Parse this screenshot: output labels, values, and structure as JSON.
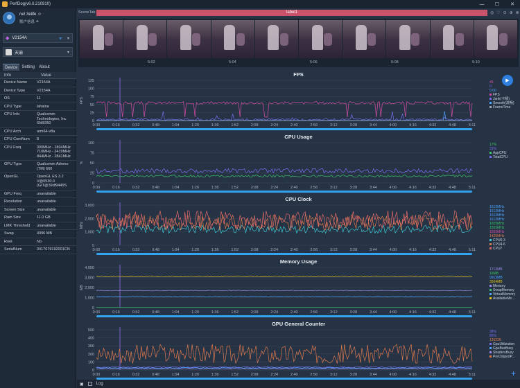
{
  "window": {
    "title": "PerfDog(v6.0.210910)",
    "min": "—",
    "max": "☐",
    "close": "✕"
  },
  "user": {
    "name": "ne! 3elife ☺",
    "sub": "账户信息 ≗"
  },
  "device_select": {
    "icon": "◆",
    "name": "V2154A",
    "wifi": "ᯤ",
    "caret": "▾"
  },
  "app_select": {
    "name": "天谕",
    "caret": "▾"
  },
  "tabs": [
    {
      "label": "Device"
    },
    {
      "label": "Setting"
    },
    {
      "label": "About"
    }
  ],
  "info_table": {
    "headers": [
      "Info",
      "Value"
    ],
    "rows": [
      {
        "k": "Device Name",
        "v": "V2154A"
      },
      {
        "k": "Device Type",
        "v": "V2154A"
      },
      {
        "k": "OS",
        "v": "11"
      },
      {
        "k": "CPU Type",
        "v": "lahaina"
      },
      {
        "k": "CPU Info",
        "v": "Qualcomm\nTechnologies, Inc\nSM8350"
      },
      {
        "k": "CPU Arch",
        "v": "arm64-v8a"
      },
      {
        "k": "CPU CoreNum",
        "v": "8"
      },
      {
        "k": "CPU Freq",
        "v": "300MHz - 1804MHz\n710MHz - 2419MHz\n844MHz - 2841MHz"
      },
      {
        "k": "GPU Type",
        "v": "Qualcomm Adreno\n(TM) 660"
      },
      {
        "k": "OpenGL",
        "v": "OpenGL ES 3.2\nV@0530.0\n(GIT@39df9449S"
      },
      {
        "k": "GPU Freq",
        "v": "unavailable"
      },
      {
        "k": "Resolution",
        "v": "unavailable"
      },
      {
        "k": "Screen Size",
        "v": "unavailable"
      },
      {
        "k": "Ram Size",
        "v": "11.0 GB"
      },
      {
        "k": "LMK Threshold",
        "v": "unavailable"
      },
      {
        "k": "Swap",
        "v": "4096 MB"
      },
      {
        "k": "Root",
        "v": "No"
      },
      {
        "k": "SerialNum",
        "v": "3417679192001CN"
      }
    ]
  },
  "scene": {
    "tab_label": "SceneTab",
    "label": "label1",
    "icons": [
      "◎",
      "♡",
      "⊙",
      "⊕",
      "⊗"
    ]
  },
  "frame_times": [
    "5:02",
    "5:04",
    "5:06",
    "5:08",
    "5:10"
  ],
  "buttons": {
    "play": "▶",
    "plus": "+"
  },
  "footer": {
    "log": "Log"
  },
  "colors": {
    "pink": "#d94ea8",
    "purple": "#7b6ff2",
    "blue": "#4da3ff",
    "green": "#3cc46a",
    "orange": "#e07a4f",
    "cyan": "#3fc9d4",
    "yellow": "#e3c21c",
    "lavender": "#9d8be8"
  },
  "chart_data": [
    {
      "type": "line",
      "title": "FPS",
      "ylabel": "FPS",
      "ylim": [
        0,
        125
      ],
      "yticks": [
        0,
        25,
        50,
        75,
        100,
        125
      ],
      "xticks": [
        "0:00",
        "0:16",
        "0:32",
        "0:48",
        "1:04",
        "1:20",
        "1:36",
        "1:52",
        "2:08",
        "2:24",
        "2:40",
        "2:56",
        "3:12",
        "3:28",
        "3:44",
        "4:00",
        "4:16",
        "4:32",
        "4:48",
        "5:11"
      ],
      "legend_values": [
        {
          "v": "45",
          "c": "#d94ea8"
        },
        {
          "v": "0",
          "c": "#7b6ff2"
        },
        {
          "v": "0.00",
          "c": "#4da3ff"
        }
      ],
      "series": [
        {
          "name": "FPS",
          "color": "#d94ea8",
          "baseline": 55,
          "noise": 4,
          "dips": 14
        },
        {
          "name": "Jank(卡顿)",
          "color": "#7b6ff2",
          "baseline": 3,
          "noise": 3,
          "spikes": 10
        },
        {
          "name": "Smooth(流畅)",
          "color": "#4da3ff",
          "baseline": 0,
          "noise": 1,
          "spikes": 6
        },
        {
          "name": "FrameTime",
          "color": "#9aa6b4",
          "baseline": 0,
          "noise": 0
        }
      ]
    },
    {
      "type": "line",
      "title": "CPU Usage",
      "ylabel": "%",
      "ylim": [
        0,
        100
      ],
      "yticks": [
        0,
        25,
        50,
        75,
        100
      ],
      "xticks": [
        "0:00",
        "0:16",
        "0:32",
        "0:48",
        "1:04",
        "1:20",
        "1:36",
        "1:52",
        "2:08",
        "2:24",
        "2:40",
        "2:56",
        "3:12",
        "3:28",
        "3:44",
        "4:00",
        "4:16",
        "4:32",
        "4:48",
        "5:11"
      ],
      "legend_values": [
        {
          "v": "17%",
          "c": "#3cc46a"
        },
        {
          "v": "31%",
          "c": "#7b6ff2"
        }
      ],
      "series": [
        {
          "name": "AppCPU",
          "color": "#3cc46a",
          "baseline": 17,
          "noise": 3
        },
        {
          "name": "TotalCPU",
          "color": "#7b6ff2",
          "baseline": 30,
          "noise": 6
        }
      ]
    },
    {
      "type": "line",
      "title": "CPU Clock",
      "ylabel": "MHz",
      "ylim": [
        0,
        3000
      ],
      "yticks": [
        0,
        1000,
        2000,
        3000
      ],
      "xticks": [
        "0:00",
        "0:16",
        "0:32",
        "0:48",
        "1:04",
        "1:20",
        "1:36",
        "1:52",
        "2:08",
        "2:24",
        "2:40",
        "2:56",
        "3:12",
        "3:28",
        "3:44",
        "4:00",
        "4:16",
        "4:32",
        "4:48",
        "5:11"
      ],
      "legend_values": [
        {
          "v": "1612MHz",
          "c": "#4da3ff"
        },
        {
          "v": "1612MHz",
          "c": "#4da3ff"
        },
        {
          "v": "1612MHz",
          "c": "#4da3ff"
        },
        {
          "v": "1612MHz",
          "c": "#4da3ff"
        },
        {
          "v": "1555MHz",
          "c": "#3cc46a"
        },
        {
          "v": "1555MHz",
          "c": "#3cc46a"
        },
        {
          "v": "1555MHz",
          "c": "#d94ea8"
        },
        {
          "v": "1420MHz",
          "c": "#e07a4f"
        }
      ],
      "series": [
        {
          "name": "CPU0-3",
          "color": "#3fc9d4",
          "baseline": 1200,
          "noise": 300
        },
        {
          "name": "CPU4-6",
          "color": "#e07a4f",
          "baseline": 1700,
          "noise": 600
        },
        {
          "name": "CPU7",
          "color": "#e36a6a",
          "baseline": 1900,
          "noise": 700
        }
      ]
    },
    {
      "type": "line",
      "title": "Memory Usage",
      "ylabel": "MB",
      "ylim": [
        0,
        4000
      ],
      "yticks": [
        0,
        1000,
        2000,
        3000,
        4000
      ],
      "xticks": [
        "0:00",
        "0:16",
        "0:32",
        "0:48",
        "1:04",
        "1:20",
        "1:36",
        "1:52",
        "2:08",
        "2:24",
        "2:40",
        "2:56",
        "3:12",
        "3:28",
        "3:44",
        "4:00",
        "4:16",
        "4:32",
        "4:48",
        "5:11"
      ],
      "legend_values": [
        {
          "v": "1713MB",
          "c": "#9d8be8"
        },
        {
          "v": "18MB",
          "c": "#3cc46a"
        },
        {
          "v": "9913MB",
          "c": "#4da3ff"
        },
        {
          "v": "3504MB",
          "c": "#e3c21c"
        }
      ],
      "series": [
        {
          "name": "Memory",
          "color": "#9d8be8",
          "baseline": 1700,
          "noise": 30
        },
        {
          "name": "SwapMemory",
          "color": "#3cc46a",
          "baseline": 18,
          "noise": 0
        },
        {
          "name": "VirtualMemory",
          "color": "#4da3ff",
          "baseline": 1100,
          "noise": 20
        },
        {
          "name": "AvailableMe...",
          "color": "#e3c21c",
          "baseline": 3100,
          "noise": 40
        }
      ]
    },
    {
      "type": "line",
      "title": "GPU General Counter",
      "ylabel": "",
      "ylim": [
        0,
        500
      ],
      "yticks": [
        0,
        100,
        200,
        300,
        400,
        500
      ],
      "xticks": [
        "0:00",
        "0:16",
        "0:32",
        "0:48",
        "1:04",
        "1:20",
        "1:36",
        "1:52",
        "2:08",
        "2:24",
        "2:40",
        "2:56",
        "3:12",
        "3:28",
        "3:44",
        "4:00",
        "4:16",
        "4:32",
        "4:48",
        "5:11"
      ],
      "legend_values": [
        {
          "v": "38%",
          "c": "#7b6ff2"
        },
        {
          "v": "85%",
          "c": "#7b6ff2"
        },
        {
          "v": "12622K",
          "c": "#e07a4f"
        }
      ],
      "series": [
        {
          "name": "GpuUtilization",
          "color": "#7b6ff2",
          "baseline": 35,
          "noise": 8
        },
        {
          "name": "GpuBusBusy",
          "color": "#4da3ff",
          "baseline": 25,
          "noise": 5
        },
        {
          "name": "ShadersBusy",
          "color": "#9d8be8",
          "baseline": 15,
          "noise": 4
        },
        {
          "name": "PreClippedP...",
          "color": "#e07a4f",
          "baseline": 200,
          "noise": 120
        }
      ]
    }
  ]
}
